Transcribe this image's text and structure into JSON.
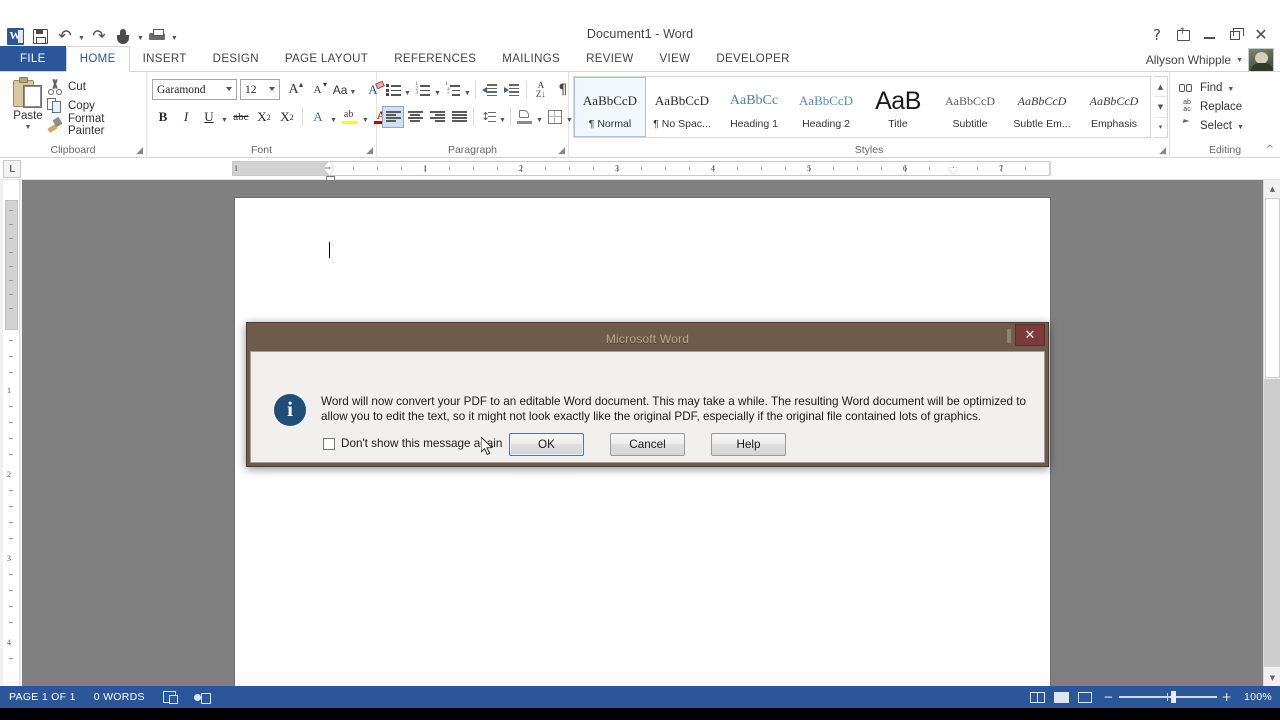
{
  "window": {
    "title": "Document1 - Word",
    "quick_access": [
      {
        "name": "word-logo",
        "label": "W"
      },
      {
        "name": "save-icon",
        "label": "Save"
      },
      {
        "name": "undo-icon",
        "label": "Undo"
      },
      {
        "name": "redo-icon",
        "label": "Redo"
      },
      {
        "name": "touch-mode-icon",
        "label": "Touch/Mouse Mode"
      },
      {
        "name": "print-preview-icon",
        "label": "Print Preview and Print"
      }
    ],
    "controls": {
      "help": "?",
      "ribbon_display": "ribbon-display-options-icon",
      "minimize": "minimize-icon",
      "restore": "restore-icon",
      "close": "✕"
    }
  },
  "account": {
    "user_name": "Allyson Whipple",
    "caret": "▾"
  },
  "ribbon": {
    "tabs": [
      {
        "label": "FILE",
        "type": "file"
      },
      {
        "label": "HOME",
        "type": "active"
      },
      {
        "label": "INSERT",
        "type": "normal"
      },
      {
        "label": "DESIGN",
        "type": "normal"
      },
      {
        "label": "PAGE LAYOUT",
        "type": "normal"
      },
      {
        "label": "REFERENCES",
        "type": "normal"
      },
      {
        "label": "MAILINGS",
        "type": "normal"
      },
      {
        "label": "REVIEW",
        "type": "normal"
      },
      {
        "label": "VIEW",
        "type": "normal"
      },
      {
        "label": "DEVELOPER",
        "type": "normal"
      }
    ],
    "clipboard": {
      "group_label": "Clipboard",
      "paste_label": "Paste",
      "cut_label": "Cut",
      "copy_label": "Copy",
      "format_painter_label": "Format Painter"
    },
    "font": {
      "group_label": "Font",
      "font_name": "Garamond",
      "font_size": "12",
      "grow_font": "A",
      "shrink_font": "A",
      "change_case": "Aa",
      "clear_formatting": "A",
      "bold": "B",
      "italic": "I",
      "underline": "U",
      "strikethrough": "abc",
      "subscript": "X",
      "subscript_sub": "2",
      "superscript": "X",
      "superscript_sup": "2",
      "text_effects": "A",
      "highlight": "ab",
      "font_color": "A"
    },
    "paragraph": {
      "group_label": "Paragraph"
    },
    "styles": {
      "group_label": "Styles",
      "items": [
        {
          "preview": "AaBbCcD",
          "name": "¶ Normal",
          "class": "sp-normal",
          "selected": true
        },
        {
          "preview": "AaBbCcD",
          "name": "¶ No Spac...",
          "class": "sp-nospace",
          "selected": false
        },
        {
          "preview": "AaBbCc",
          "name": "Heading 1",
          "class": "sp-h1",
          "selected": false
        },
        {
          "preview": "AaBbCcD",
          "name": "Heading 2",
          "class": "sp-h2",
          "selected": false
        },
        {
          "preview": "AaB",
          "name": "Title",
          "class": "sp-title",
          "selected": false
        },
        {
          "preview": "AaBbCcD",
          "name": "Subtitle",
          "class": "sp-sub",
          "selected": false
        },
        {
          "preview": "AaBbCcD",
          "name": "Subtle Em...",
          "class": "sp-subem",
          "selected": false
        },
        {
          "preview": "AaBbCcD",
          "name": "Emphasis",
          "class": "sp-em",
          "selected": false
        }
      ]
    },
    "editing": {
      "group_label": "Editing",
      "find_label": "Find",
      "replace_label": "Replace",
      "select_label": "Select"
    }
  },
  "ruler": {
    "tab_selector": "L",
    "numbers": [
      "1",
      "1",
      "2",
      "3",
      "4",
      "5",
      "6",
      "7"
    ],
    "left_margin_inches": 1,
    "right_indent_inches": 6.5
  },
  "dialog": {
    "title": "Microsoft Word",
    "close_label": "✕",
    "icon": "info-icon",
    "message": "Word will now convert your PDF to an editable Word document. This may take a while. The resulting Word document will be optimized to allow you to edit the text, so it might not look exactly like the original PDF, especially if the original file contained lots of graphics.",
    "checkbox_label": "Don't show this message again",
    "checkbox_checked": false,
    "buttons": [
      {
        "label": "OK",
        "default": true
      },
      {
        "label": "Cancel",
        "default": false
      },
      {
        "label": "Help",
        "default": false
      }
    ]
  },
  "status_bar": {
    "page_info": "PAGE 1 OF 1",
    "word_count": "0 WORDS",
    "proofing_icon": "proofing-errors-icon",
    "language_icon": "language-icon",
    "views": [
      {
        "name": "read-mode-view-button"
      },
      {
        "name": "print-layout-view-button"
      },
      {
        "name": "web-layout-view-button"
      }
    ],
    "zoom_out": "−",
    "zoom_in": "+",
    "zoom_level": "100%"
  },
  "colors": {
    "word_blue": "#2b579a",
    "dialog_frame": "#6e5b49",
    "dialog_close": "#7b3b3b",
    "info_blue": "#1f4e79",
    "highlight_yellow": "#ffff00",
    "font_color_red": "#c00000"
  }
}
